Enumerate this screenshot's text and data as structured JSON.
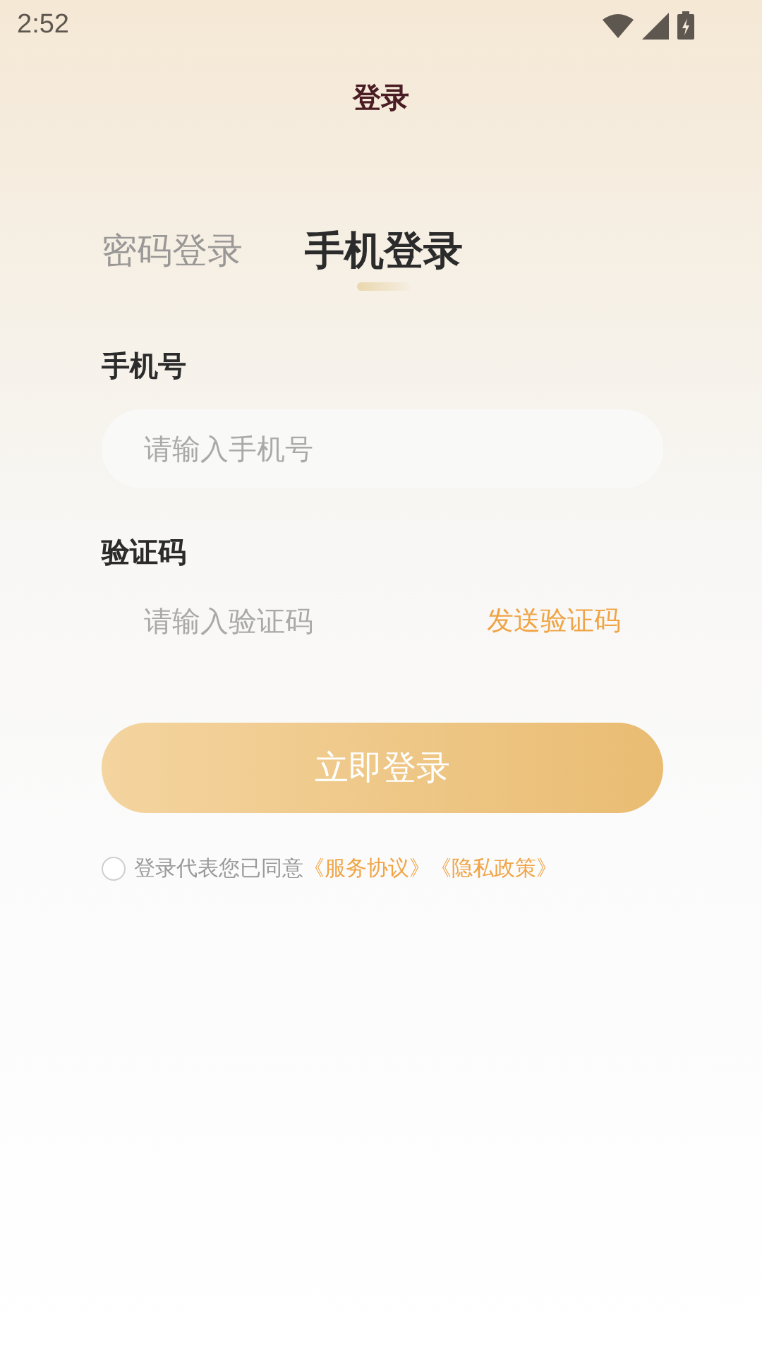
{
  "status_bar": {
    "time": "2:52"
  },
  "header": {
    "title": "登录"
  },
  "tabs": [
    {
      "label": "密码登录",
      "selected": false
    },
    {
      "label": "手机登录",
      "selected": true
    }
  ],
  "fields": [
    {
      "label": "手机号",
      "placeholder": "请输入手机号"
    },
    {
      "label": "验证码",
      "placeholder": "请输入验证码",
      "action": "发送验证码"
    }
  ],
  "submit": "立即登录",
  "agreement": {
    "checked": false,
    "text": "登录代表您已同意",
    "links": [
      "《服务协议》",
      "《隐私政策》"
    ]
  }
}
